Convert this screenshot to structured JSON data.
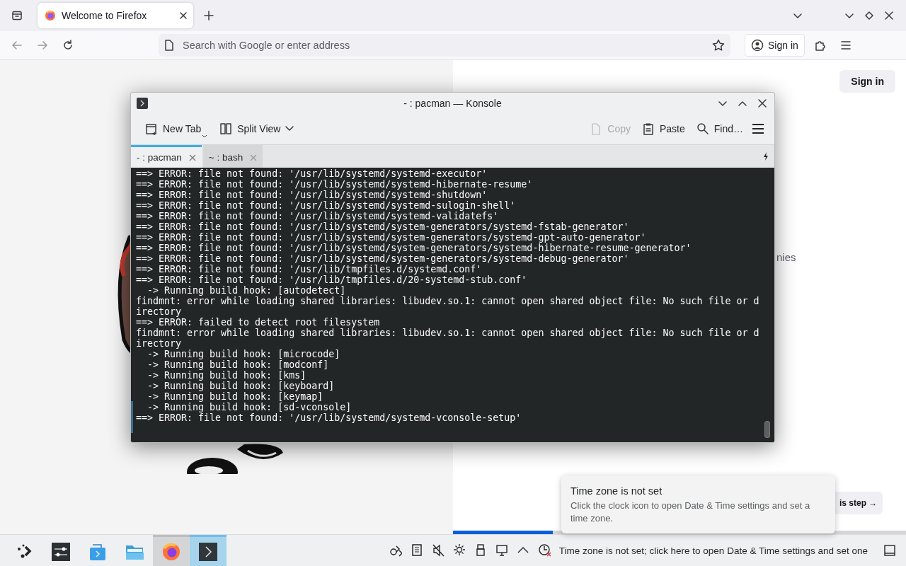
{
  "browser": {
    "tabs": [
      {
        "title": "Welcome to Firefox",
        "selected": true
      }
    ],
    "address_bar": {
      "placeholder": "Search with Google or enter address"
    },
    "sign_in_button": "Sign in",
    "page": {
      "sign_in_button": "Sign in",
      "text_fragment": "nies",
      "skip_button": "is step →",
      "progress": {
        "level": 0.22
      }
    }
  },
  "konsole": {
    "title": "- : pacman — Konsole",
    "toolbar": [
      {
        "label": "New Tab",
        "disabled": false
      },
      {
        "label": "Split View",
        "disabled": false
      },
      {
        "label": "Copy",
        "disabled": true
      },
      {
        "label": "Paste",
        "disabled": false
      },
      {
        "label": "Find…",
        "disabled": false
      }
    ],
    "tabs": [
      {
        "label": "- : pacman",
        "selected": true
      },
      {
        "label": "~ : bash",
        "selected": false
      }
    ],
    "lines": [
      "==> ERROR: file not found: '/usr/lib/systemd/systemd-executor'",
      "==> ERROR: file not found: '/usr/lib/systemd/systemd-hibernate-resume'",
      "==> ERROR: file not found: '/usr/lib/systemd/systemd-shutdown'",
      "==> ERROR: file not found: '/usr/lib/systemd/systemd-sulogin-shell'",
      "==> ERROR: file not found: '/usr/lib/systemd/systemd-validatefs'",
      "==> ERROR: file not found: '/usr/lib/systemd/system-generators/systemd-fstab-generator'",
      "==> ERROR: file not found: '/usr/lib/systemd/system-generators/systemd-gpt-auto-generator'",
      "==> ERROR: file not found: '/usr/lib/systemd/system-generators/systemd-hibernate-resume-generator'",
      "==> ERROR: file not found: '/usr/lib/systemd/system-generators/systemd-debug-generator'",
      "==> ERROR: file not found: '/usr/lib/tmpfiles.d/systemd.conf'",
      "==> ERROR: file not found: '/usr/lib/tmpfiles.d/20-systemd-stub.conf'",
      "  -> Running build hook: [autodetect]",
      "findmnt: error while loading shared libraries: libudev.so.1: cannot open shared object file: No such file or d",
      "irectory",
      "==> ERROR: failed to detect root filesystem",
      "findmnt: error while loading shared libraries: libudev.so.1: cannot open shared object file: No such file or d",
      "irectory",
      "  -> Running build hook: [microcode]",
      "  -> Running build hook: [modconf]",
      "  -> Running build hook: [kms]",
      "  -> Running build hook: [keyboard]",
      "  -> Running build hook: [keymap]",
      "  -> Running build hook: [sd-vconsole]",
      "==> ERROR: file not found: '/usr/lib/systemd/systemd-vconsole-setup'"
    ]
  },
  "notification": {
    "title": "Time zone is not set",
    "body": "Click the clock icon to open Date & Time settings and set a time zone."
  },
  "taskbar": {
    "apps": [
      {
        "running": false,
        "selected": false
      },
      {
        "running": false,
        "selected": false
      },
      {
        "running": false,
        "selected": false
      },
      {
        "running": false,
        "selected": false
      },
      {
        "running": true,
        "selected": false
      },
      {
        "running": true,
        "selected": true
      }
    ],
    "status_text": "Time zone is not set; click here to open Date & Time settings and set one"
  }
}
